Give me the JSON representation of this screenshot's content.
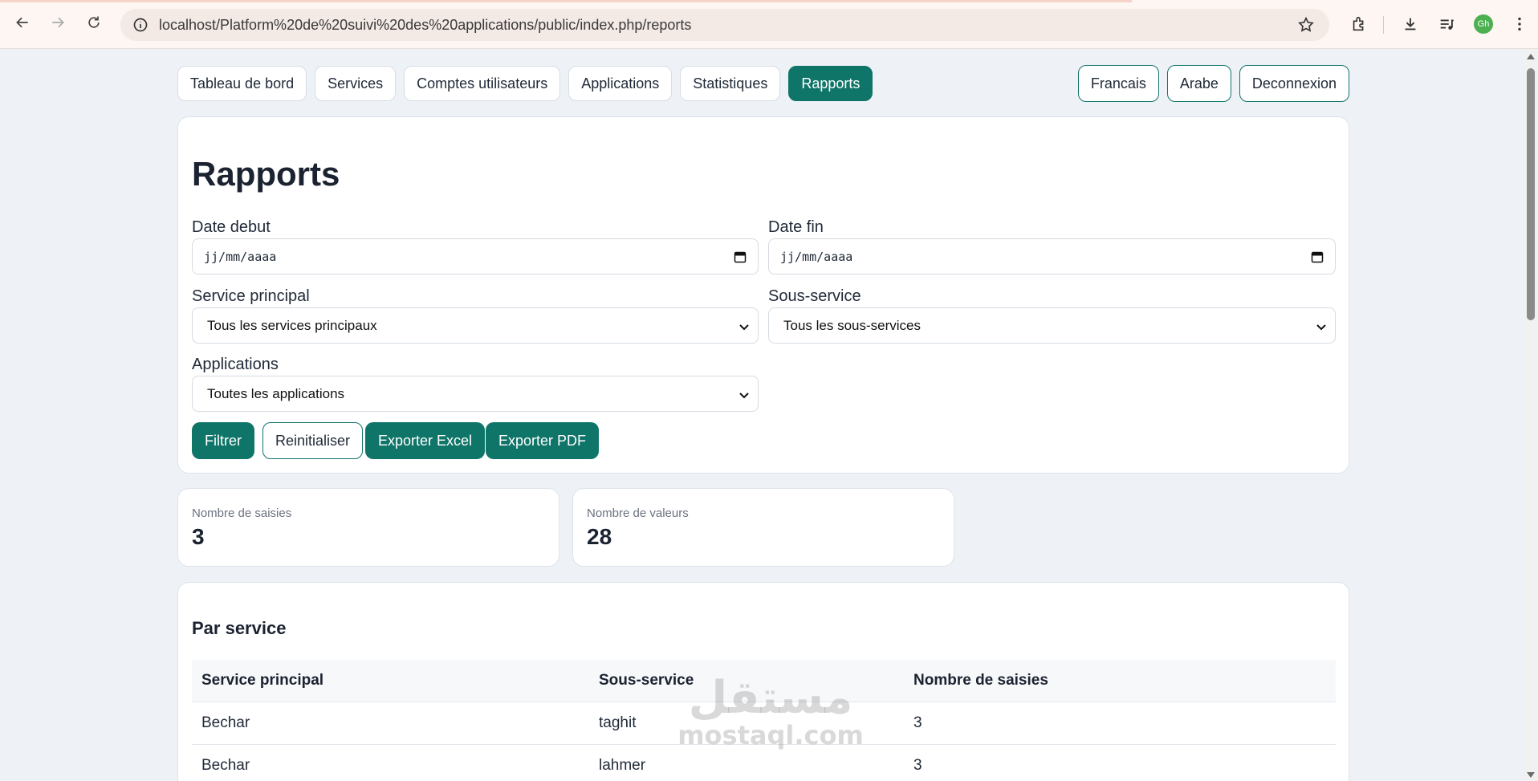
{
  "browser": {
    "url": "localhost/Platform%20de%20suivi%20des%20applications/public/index.php/reports",
    "profile_initials": "Gh"
  },
  "nav": {
    "tabs": [
      {
        "label": "Tableau de bord"
      },
      {
        "label": "Services"
      },
      {
        "label": "Comptes utilisateurs"
      },
      {
        "label": "Applications"
      },
      {
        "label": "Statistiques"
      },
      {
        "label": "Rapports",
        "active": true
      }
    ],
    "lang_fr": "Francais",
    "lang_ar": "Arabe",
    "logout": "Deconnexion"
  },
  "reports": {
    "title": "Rapports",
    "date_start_label": "Date debut",
    "date_start_value": "jj/mm/aaaa",
    "date_end_label": "Date fin",
    "date_end_value": "jj/mm/aaaa",
    "service_label": "Service principal",
    "service_value": "Tous les services principaux",
    "subservice_label": "Sous-service",
    "subservice_value": "Tous les sous-services",
    "apps_label": "Applications",
    "apps_value": "Toutes les applications",
    "buttons": {
      "filter": "Filtrer",
      "reset": "Reinitialiser",
      "export_excel": "Exporter Excel",
      "export_pdf": "Exporter PDF"
    }
  },
  "stats": {
    "entries_label": "Nombre de saisies",
    "entries_value": "3",
    "values_label": "Nombre de valeurs",
    "values_value": "28"
  },
  "by_service": {
    "title": "Par service",
    "columns": [
      "Service principal",
      "Sous-service",
      "Nombre de saisies"
    ],
    "rows": [
      [
        "Bechar",
        "taghit",
        "3"
      ],
      [
        "Bechar",
        "lahmer",
        "3"
      ]
    ]
  },
  "watermark": {
    "arabic": "مستقل",
    "latin": "mostaql.com"
  },
  "colors": {
    "accent": "#107569",
    "page_bg": "#eef2f7"
  }
}
